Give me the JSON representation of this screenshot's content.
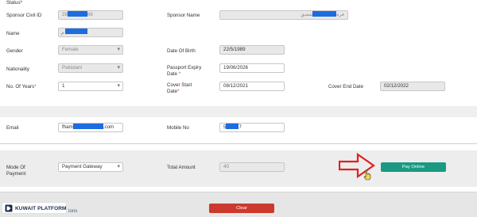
{
  "form": {
    "status_label": "Status*",
    "sponsor_civil_id": {
      "label": "Sponsor Civil ID",
      "value_prefix": "28",
      "value_suffix": "66"
    },
    "sponsor_name": {
      "label": "Sponsor Name",
      "value_prefix": "فرة",
      "value_suffix": "شعيق"
    },
    "name": {
      "label": "Name",
      "value_prefix": "م"
    },
    "gender": {
      "label": "Gender",
      "value": "Female"
    },
    "date_of_birth": {
      "label": "Date Of Birth",
      "value": "22/5/1989"
    },
    "nationality": {
      "label": "Nationality",
      "value": "Pakistani"
    },
    "passport_expiry": {
      "label_line1": "Passport Expiry",
      "label_line2": "Date",
      "value": "19/06/2026"
    },
    "no_of_years": {
      "label": "No. Of Years",
      "value": "1"
    },
    "cover_start": {
      "label_line1": "Cover Start",
      "label_line2": "Date",
      "value": "08/12/2021"
    },
    "cover_end": {
      "label": "Cover End Date",
      "value": "02/12/2022"
    },
    "email": {
      "label": "Email",
      "value_prefix": "fham",
      "value_suffix": ".com"
    },
    "mobile": {
      "label": "Mobile No",
      "value_prefix": "5",
      "value_suffix": "7"
    }
  },
  "payment": {
    "mode_label_line1": "Mode Of",
    "mode_label_line2": "Payment",
    "mode_value": "Payment Gateway",
    "total_label": "Total Amount",
    "total_value": "40",
    "pay_button": "Pay Online"
  },
  "footer": {
    "brand": "KUWAIT PLATFORM",
    "partial_link": "ions",
    "clear_button": "Clear"
  },
  "colors": {
    "pay": "#1a9a82",
    "clear": "#cc3a2e",
    "arrow": "#e02020",
    "redact": "#1d6ce0"
  }
}
